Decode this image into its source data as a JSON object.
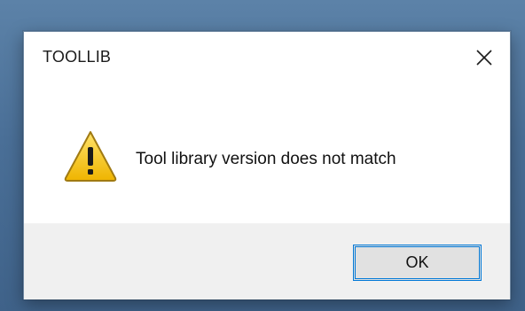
{
  "dialog": {
    "title": "TOOLLIB",
    "message": "Tool library version does not match",
    "icon": "warning-icon",
    "close_icon": "close-icon",
    "ok_label": "OK"
  },
  "colors": {
    "desktop": "#4a6f97",
    "dialog_bg": "#ffffff",
    "footer_bg": "#f0f0f0",
    "button_bg": "#e1e1e1",
    "button_focus_border": "#0078d7",
    "warning_yellow": "#f2c21b"
  }
}
